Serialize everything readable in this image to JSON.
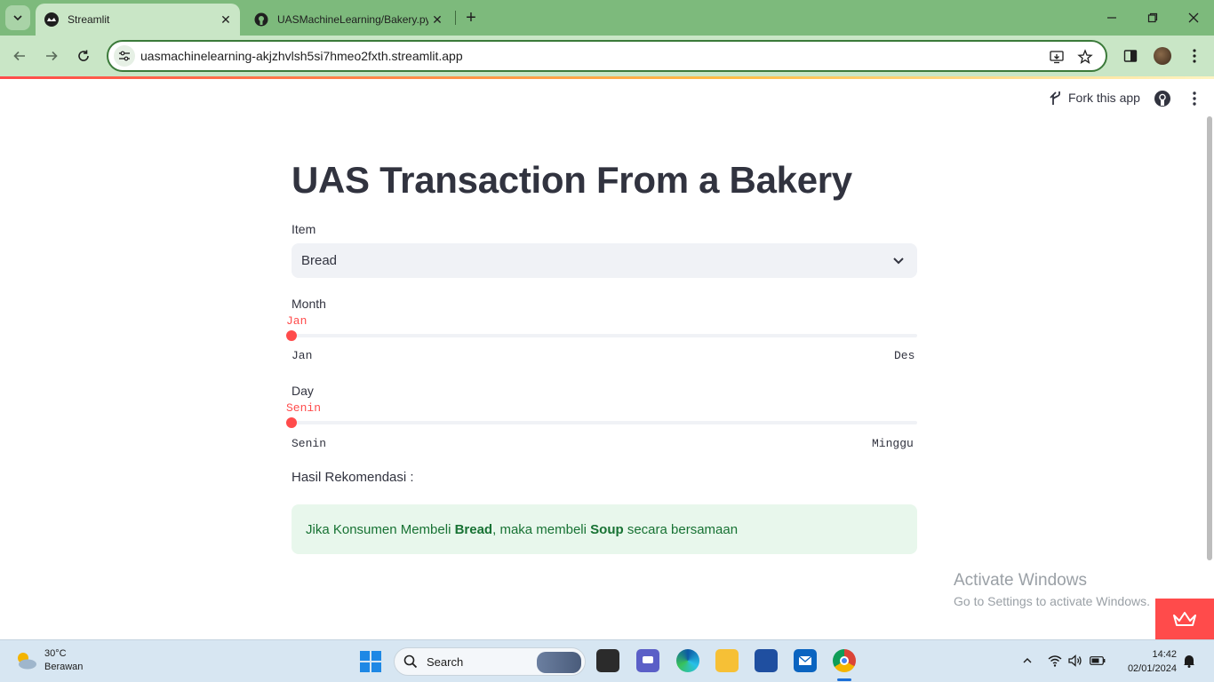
{
  "browser": {
    "tabs": [
      {
        "title": "Streamlit",
        "active": true
      },
      {
        "title": "UASMachineLearning/Bakery.py",
        "active": false
      }
    ],
    "url": "uasmachinelearning-akjzhvlsh5si7hmeo2fxth.streamlit.app"
  },
  "header": {
    "fork_label": "Fork this app"
  },
  "main": {
    "title": "UAS Transaction From a Bakery",
    "item_select": {
      "label": "Item",
      "value": "Bread"
    },
    "month_slider": {
      "label": "Month",
      "current": "Jan",
      "min": "Jan",
      "max": "Des",
      "position_fraction": 0
    },
    "day_slider": {
      "label": "Day",
      "current": "Senin",
      "min": "Senin",
      "max": "Minggu",
      "position_fraction": 0
    },
    "result_label": "Hasil Rekomendasi :",
    "result": {
      "prefix": "Jika Konsumen Membeli ",
      "item": "Bread",
      "middle": ", maka membeli ",
      "recommendation": "Soup",
      "suffix": " secara bersamaan"
    }
  },
  "watermark": {
    "line1": "Activate Windows",
    "line2": "Go to Settings to activate Windows."
  },
  "taskbar": {
    "weather_temp": "30°C",
    "weather_desc": "Berawan",
    "search_placeholder": "Search",
    "time": "14:42",
    "date": "02/01/2024"
  },
  "colors": {
    "accent": "#ff4b4b",
    "success_bg": "#e8f7ec",
    "success_text": "#177233",
    "chrome_tabbar": "#7dba7c",
    "chrome_toolbar": "#c9e6c6"
  }
}
